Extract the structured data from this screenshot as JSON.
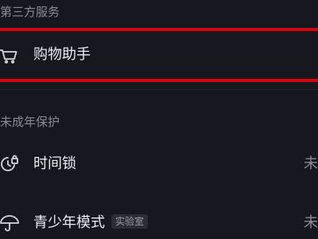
{
  "sections": {
    "third_party": {
      "header": "第三方服务",
      "shopping": {
        "label": "购物助手",
        "icon": "shopping-cart-icon"
      }
    },
    "minor_protection": {
      "header": "未成年保护",
      "time_lock": {
        "label": "时间锁",
        "value": "未",
        "icon": "time-lock-icon"
      },
      "teen_mode": {
        "label": "青少年模式",
        "badge": "实验室",
        "value": "未",
        "icon": "umbrella-icon"
      }
    }
  },
  "colors": {
    "background": "#16171f",
    "primary_text": "#ecedf1",
    "secondary_text": "#8a8b93",
    "highlight": "#d9000b"
  }
}
